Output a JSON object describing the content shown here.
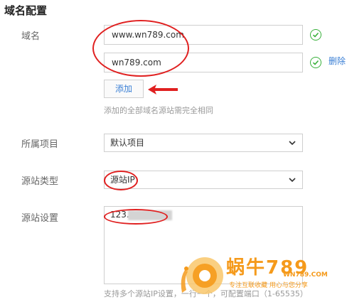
{
  "section_title": "域名配置",
  "domain": {
    "label": "域名",
    "values": [
      "www.wn789.com",
      "wn789.com"
    ],
    "delete_label": "删除",
    "add_label": "添加",
    "hint": "添加的全部域名源站需完全相同"
  },
  "project": {
    "label": "所属项目",
    "selected": "默认项目"
  },
  "origin_type": {
    "label": "源站类型",
    "selected": "源站IP"
  },
  "origin_settings": {
    "label": "源站设置",
    "value": "123.",
    "hint": "支持多个源站IP设置，一行一个，可配置端口（1-65535）"
  },
  "watermark": {
    "brand": "蜗牛789",
    "site": "WN789.COM",
    "tagline": "专注互联收藏   用心与您分享"
  },
  "colors": {
    "annotation_red": "#e02020",
    "success_green": "#38b03a",
    "link_blue": "#3a7fd5",
    "watermark_orange": "#f59a1b"
  }
}
